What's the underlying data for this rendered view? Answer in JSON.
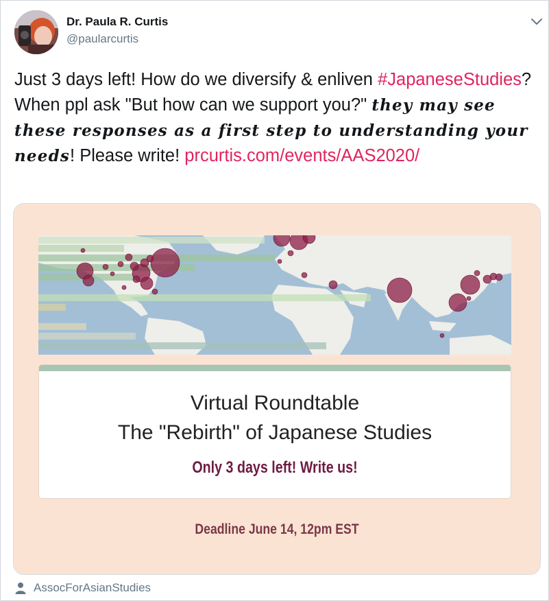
{
  "author": {
    "name": "Dr. Paula R. Curtis",
    "handle": "@paularcurtis"
  },
  "tweet": {
    "text_part1": "Just 3 days left! How do we diversify & enliven ",
    "hashtag": "#JapaneseStudies",
    "text_part2": "? When ppl ask \"But how can we support you?\" ",
    "styled_text": "they may see these responses as a first step to understanding your needs",
    "text_part3": "! Please write! ",
    "link": "prcurtis.com/events/AAS2020/"
  },
  "card": {
    "title_line1": "Virtual Roundtable",
    "title_line2": "The \"Rebirth\" of Japanese Studies",
    "callout": "Only 3 days left! Write us!",
    "deadline": "Deadline June 14, 12pm EST"
  },
  "footer": {
    "tagged_user": "AssocForAsianStudies"
  },
  "colors": {
    "link": "#e0245e",
    "card_background": "#fbe3d3",
    "callout": "#6e1b44",
    "deadline": "#7a3848",
    "map_ocean": "#a3bfd6",
    "map_land": "#eeeeea",
    "marker": "#8b1e46"
  },
  "icons": {
    "menu": "chevron-down-icon",
    "footer": "person-icon"
  }
}
